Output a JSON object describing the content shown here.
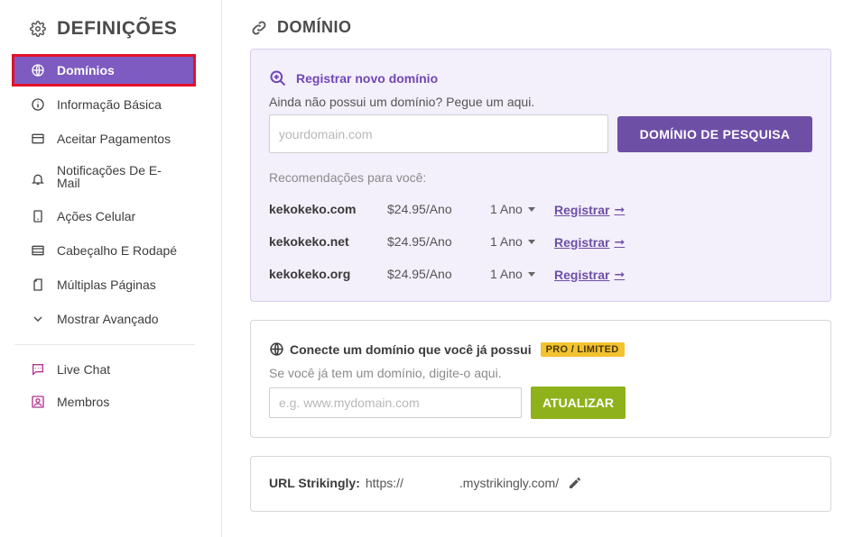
{
  "sidebar": {
    "title": "DEFINIÇÕES",
    "items": [
      {
        "label": "Domínios",
        "icon": "globe-icon"
      },
      {
        "label": "Informação Básica",
        "icon": "info-icon"
      },
      {
        "label": "Aceitar Pagamentos",
        "icon": "card-icon"
      },
      {
        "label": "Notificações De E-Mail",
        "icon": "bell-icon"
      },
      {
        "label": "Ações Celular",
        "icon": "mobile-icon"
      },
      {
        "label": "Cabeçalho E Rodapé",
        "icon": "header-footer-icon"
      },
      {
        "label": "Múltiplas Páginas",
        "icon": "pages-icon"
      },
      {
        "label": "Mostrar Avançado",
        "icon": "chevron-down-icon"
      },
      {
        "label": "Live Chat",
        "icon": "chat-icon"
      },
      {
        "label": "Membros",
        "icon": "member-icon"
      }
    ]
  },
  "main": {
    "title": "DOMÍNIO",
    "register": {
      "heading": "Registrar novo domínio",
      "subtitle": "Ainda não possui um domínio? Pegue um aqui.",
      "placeholder": "yourdomain.com",
      "search_button": "DOMÍNIO DE PESQUISA",
      "recommendations_label": "Recomendações para você:",
      "recommendations": [
        {
          "domain": "kekokeko.com",
          "price": "$24.95/Ano",
          "term": "1 Ano",
          "action": "Registrar"
        },
        {
          "domain": "kekokeko.net",
          "price": "$24.95/Ano",
          "term": "1 Ano",
          "action": "Registrar"
        },
        {
          "domain": "kekokeko.org",
          "price": "$24.95/Ano",
          "term": "1 Ano",
          "action": "Registrar"
        }
      ]
    },
    "connect": {
      "heading": "Conecte um domínio que você já possui",
      "badge": "PRO / LIMITED",
      "subtitle": "Se você já tem um domínio, digite-o aqui.",
      "placeholder": "e.g. www.mydomain.com",
      "update_button": "ATUALIZAR"
    },
    "url": {
      "label": "URL Strikingly:",
      "prefix": "https://",
      "suffix": ".mystrikingly.com/"
    }
  },
  "colors": {
    "accent": "#7e5bc1",
    "button_purple": "#6e4fa6",
    "button_green": "#8fb21c",
    "badge_yellow": "#f2c230",
    "active_outline": "#e5102a"
  }
}
